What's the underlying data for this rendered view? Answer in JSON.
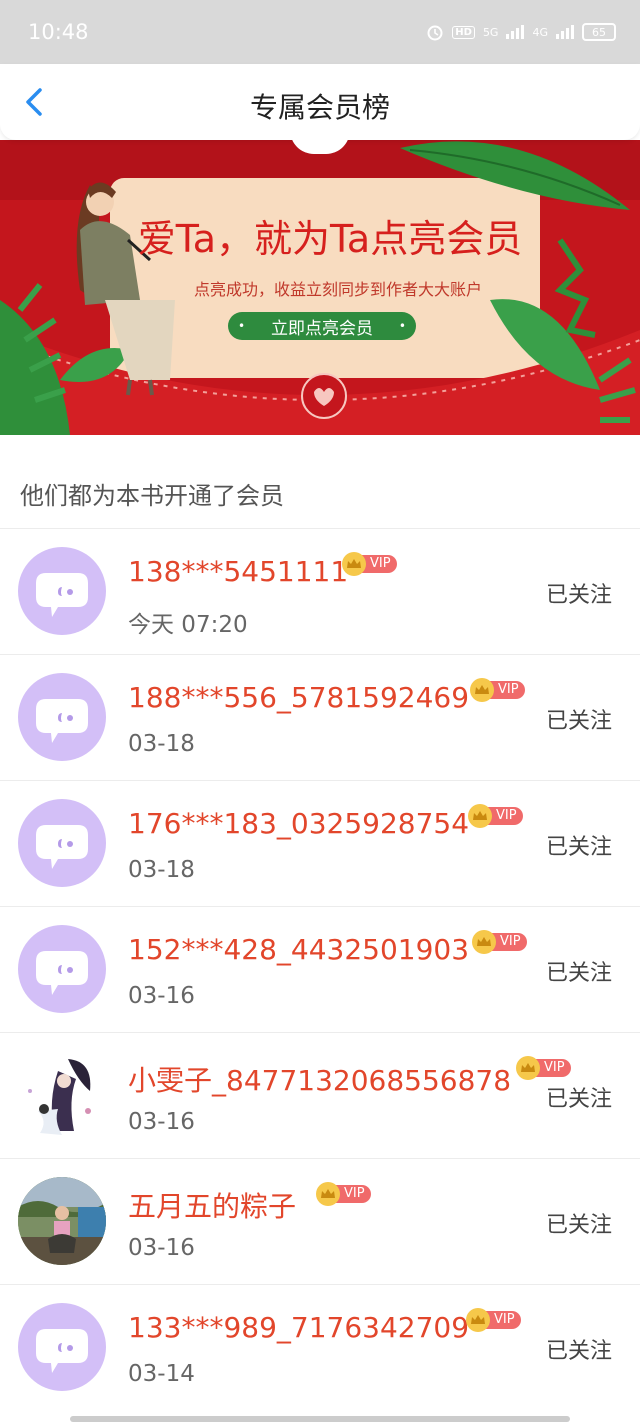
{
  "status_bar": {
    "time": "10:48",
    "hd": "HD",
    "sim1": "5G",
    "sim2": "4G",
    "battery": "65"
  },
  "nav": {
    "title": "专属会员榜",
    "back_icon": "chevron-left-icon"
  },
  "banner": {
    "title": "爱Ta，就为Ta点亮会员",
    "subtitle": "点亮成功，收益立刻同步到作者大大账户",
    "button": "立即点亮会员"
  },
  "section": {
    "title": "他们都为本书开通了会员"
  },
  "vip_label": "VIP",
  "colors": {
    "accent_red": "#e2462b",
    "banner_red": "#c4161d",
    "button_green": "#2e8b3e",
    "avatar_lilac": "#d3bff7"
  },
  "members": [
    {
      "name": "138***5451111",
      "date": "今天  07:20",
      "follow": "已关注",
      "avatar": "default-chat-avatar"
    },
    {
      "name": "188***556_5781592469",
      "date": "03-18",
      "follow": "已关注",
      "avatar": "default-chat-avatar"
    },
    {
      "name": "176***183_0325928754",
      "date": "03-18",
      "follow": "已关注",
      "avatar": "default-chat-avatar"
    },
    {
      "name": "152***428_4432501903",
      "date": "03-16",
      "follow": "已关注",
      "avatar": "default-chat-avatar"
    },
    {
      "name": "小雯子_8477132068556878",
      "date": "03-16",
      "follow": "已关注",
      "avatar": "illustration-avatar"
    },
    {
      "name": "五月五的粽子",
      "date": "03-16",
      "follow": "已关注",
      "avatar": "photo-avatar"
    },
    {
      "name": "133***989_7176342709",
      "date": "03-14",
      "follow": "已关注",
      "avatar": "default-chat-avatar"
    }
  ]
}
